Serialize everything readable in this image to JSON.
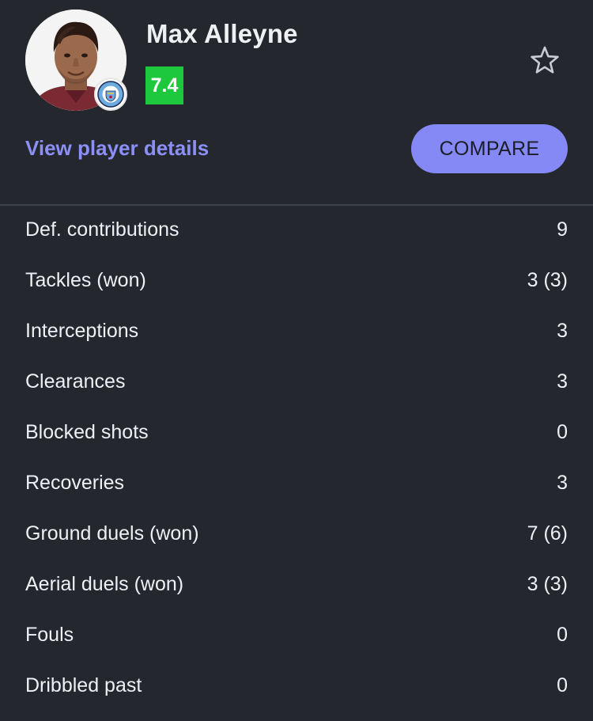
{
  "player": {
    "name": "Max Alleyne",
    "rating": "7.4",
    "club_badge_icon": "manchester-city-badge-icon",
    "rating_color": "#1ec83c"
  },
  "actions": {
    "details_link": "View player details",
    "compare_button": "COMPARE",
    "favorite_icon": "star-outline-icon"
  },
  "colors": {
    "background": "#24272d",
    "accent": "#8589f6",
    "link": "#8b8ff6"
  },
  "stats": [
    {
      "label": "Def. contributions",
      "value": "9"
    },
    {
      "label": "Tackles (won)",
      "value": "3 (3)"
    },
    {
      "label": "Interceptions",
      "value": "3"
    },
    {
      "label": "Clearances",
      "value": "3"
    },
    {
      "label": "Blocked shots",
      "value": "0"
    },
    {
      "label": "Recoveries",
      "value": "3"
    },
    {
      "label": "Ground duels (won)",
      "value": "7 (6)"
    },
    {
      "label": "Aerial duels (won)",
      "value": "3 (3)"
    },
    {
      "label": "Fouls",
      "value": "0"
    },
    {
      "label": "Dribbled past",
      "value": "0"
    }
  ]
}
